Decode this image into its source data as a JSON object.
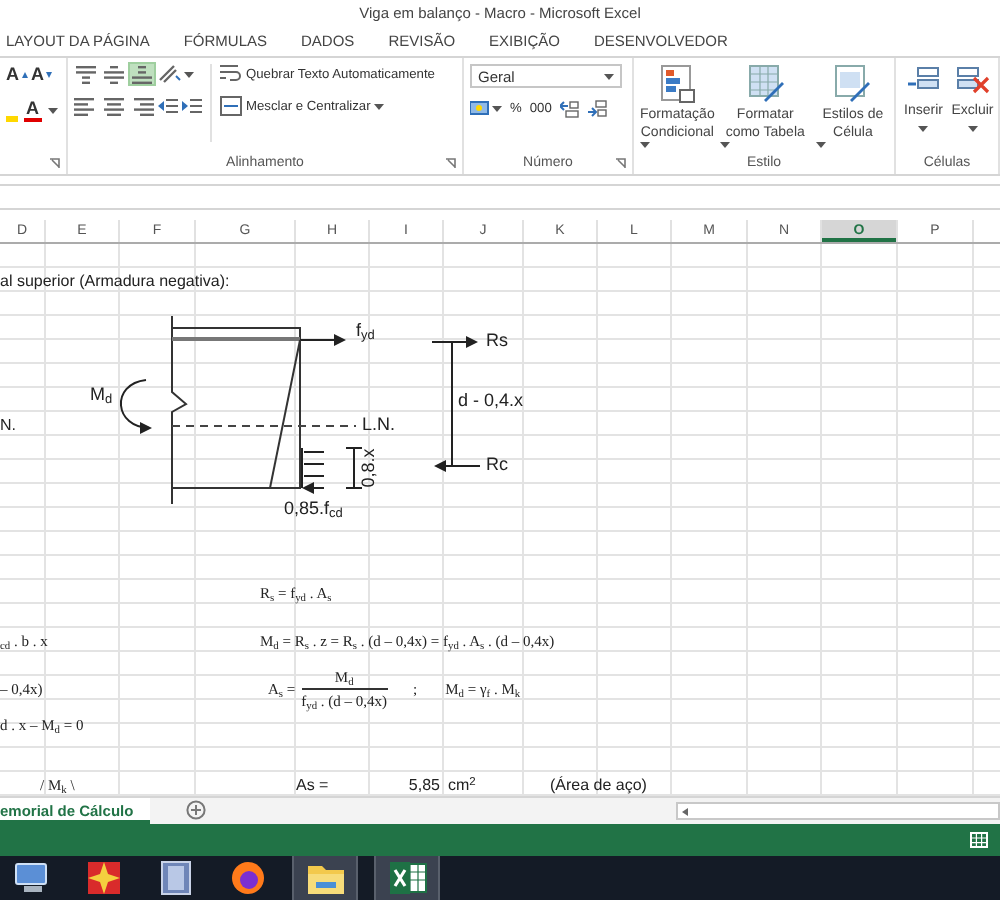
{
  "window": {
    "title": "Viga em balanço - Macro - Microsoft Excel"
  },
  "ribbon_tabs": [
    {
      "label": "LAYOUT DA PÁGINA",
      "selected": false
    },
    {
      "label": "FÓRMULAS",
      "selected": false
    },
    {
      "label": "DADOS",
      "selected": false
    },
    {
      "label": "REVISÃO",
      "selected": false
    },
    {
      "label": "EXIBIÇÃO",
      "selected": false
    },
    {
      "label": "DESENVOLVEDOR",
      "selected": false
    }
  ],
  "ribbon": {
    "font": {
      "grow_font": "A",
      "shrink_font": "A",
      "font_color": "A"
    },
    "alignment": {
      "vertical_align": [
        {
          "selected": false
        },
        {
          "selected": false
        },
        {
          "selected": true
        }
      ],
      "wrap_text": "Quebrar Texto Automaticamente",
      "merge_center": "Mesclar e Centralizar",
      "label": "Alinhamento"
    },
    "number": {
      "format": "Geral",
      "percent": "%",
      "thousands": "000",
      "label": "Número"
    },
    "styles": {
      "buttons": [
        {
          "kind": "conditional",
          "label": "Formatação Condicional"
        },
        {
          "kind": "table",
          "label": "Formatar como Tabela"
        },
        {
          "kind": "cell",
          "label": "Estilos de Célula"
        }
      ],
      "label": "Estilo"
    },
    "cells": {
      "buttons": [
        {
          "kind": "insert",
          "label": "Inserir"
        },
        {
          "kind": "delete",
          "label": "Excluir"
        }
      ],
      "label": "Células"
    }
  },
  "columns": [
    {
      "label": "D",
      "selected": false
    },
    {
      "label": "E",
      "selected": false
    },
    {
      "label": "F",
      "selected": false
    },
    {
      "label": "G",
      "selected": false
    },
    {
      "label": "H",
      "selected": false
    },
    {
      "label": "I",
      "selected": false
    },
    {
      "label": "J",
      "selected": false
    },
    {
      "label": "K",
      "selected": false
    },
    {
      "label": "L",
      "selected": false
    },
    {
      "label": "M",
      "selected": false
    },
    {
      "label": "N",
      "selected": false
    },
    {
      "label": "O",
      "selected": true
    },
    {
      "label": "P",
      "selected": false
    }
  ],
  "sheet": {
    "heading": "al superior (Armadura negativa):",
    "neutral_line_label": "N.",
    "left_formulas": [
      "$_{cd}$ . b . x",
      "– 0,4x)",
      "d . x – M$_{d}$ = 0",
      "/ M$_{k}$ \\"
    ],
    "formula_rs": "R$_{s}$ = f$_{yd}$ . A$_{s}$",
    "formula_md": "M$_{d}$ = R$_{s}$ . z = R$_{s}$ . (d – 0,4x) = f$_{yd}$ . A$_{s}$ . (d – 0,4x)",
    "formula_as": {
      "lhs": "A$_{s}$ =",
      "numerator": "M$_{d}$",
      "denominator": "f$_{yd}$ . (d – 0,4x)",
      "separator": ";",
      "rhs": "M$_{d}$ = γ$_{f}$ . M$_{k}$"
    },
    "result": {
      "label": "As =",
      "value": "5,85",
      "unit": "cm$^{2}$",
      "note": "(Área de aço)"
    }
  },
  "diagram": {
    "steel_stress": "f$_{yd}$",
    "moment": "M$_{d}$",
    "neutral_line": "L.N.",
    "block_depth": "0,8.x",
    "concrete_stress": "0,85.f$_{cd}$",
    "tension_force": "Rs",
    "lever_arm": "d - 0,4.x",
    "compression_force": "Rc"
  },
  "sheet_tabs": [
    {
      "label": "emorial de Cálculo",
      "selected": true
    }
  ],
  "taskbar": [
    {
      "kind": "monitor",
      "running": false
    },
    {
      "kind": "star",
      "running": false
    },
    {
      "kind": "floppy",
      "running": false
    },
    {
      "kind": "firefox",
      "running": false
    },
    {
      "kind": "folder",
      "running": true
    },
    {
      "kind": "excel",
      "running": true
    }
  ]
}
